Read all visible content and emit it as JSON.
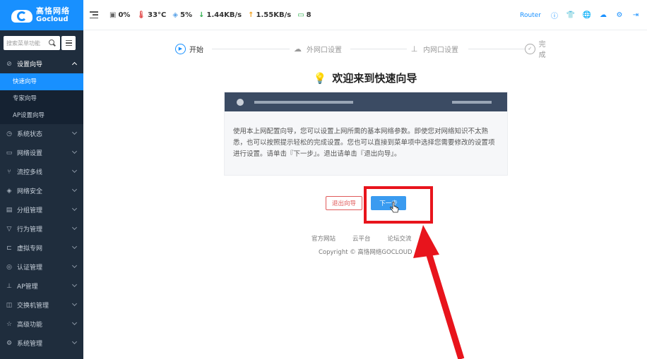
{
  "brand": {
    "cn": "高恪网络",
    "en": "Gocloud"
  },
  "sidebar": {
    "search_placeholder": "搜索菜单功能",
    "groups": [
      {
        "label": "设置向导",
        "open": true,
        "icon": "compass-icon"
      },
      {
        "label": "系统状态",
        "icon": "clock-icon"
      },
      {
        "label": "网络设置",
        "icon": "monitor-icon"
      },
      {
        "label": "流控多线",
        "icon": "split-icon"
      },
      {
        "label": "网络安全",
        "icon": "shield-icon"
      },
      {
        "label": "分组管理",
        "icon": "group-icon"
      },
      {
        "label": "行为管理",
        "icon": "filter-icon"
      },
      {
        "label": "虚拟专网",
        "icon": "vpn-icon"
      },
      {
        "label": "认证管理",
        "icon": "auth-icon"
      },
      {
        "label": "AP管理",
        "icon": "sitemap-icon"
      },
      {
        "label": "交换机管理",
        "icon": "switch-icon"
      },
      {
        "label": "高级功能",
        "icon": "star-icon"
      },
      {
        "label": "系统管理",
        "icon": "gear-icon"
      }
    ],
    "sub_items": [
      {
        "label": "快速向导",
        "active": true
      },
      {
        "label": "专家向导"
      },
      {
        "label": "AP设置向导"
      }
    ]
  },
  "topbar": {
    "cpu": "0%",
    "temp": "33°C",
    "mem": "5%",
    "down": "1.44KB/s",
    "up": "1.55KB/s",
    "devices": "8",
    "router_label": "Router"
  },
  "steps": [
    {
      "label": "开始",
      "active": true
    },
    {
      "label": "外网口设置"
    },
    {
      "label": "内网口设置"
    },
    {
      "label": "完成"
    }
  ],
  "welcome": "欢迎来到快速向导",
  "card_text": "使用本上网配置向导，您可以设置上网所需的基本网络参数。即使您对网络知识不太熟悉，也可以按照提示轻松的完成设置。您也可以直接到菜单项中选择您需要修改的设置项进行设置。请单击『下一步』。退出请单击『退出向导』。",
  "buttons": {
    "exit": "退出向导",
    "next": "下一步"
  },
  "footer": {
    "links": [
      "官方网站",
      "云平台",
      "论坛交流"
    ],
    "copyright": "Copyright © 高恪网络GOCLOUD"
  },
  "colors": {
    "accent": "#1890ff",
    "sidebar": "#1f2d3d",
    "highlight": "#e8141c"
  }
}
